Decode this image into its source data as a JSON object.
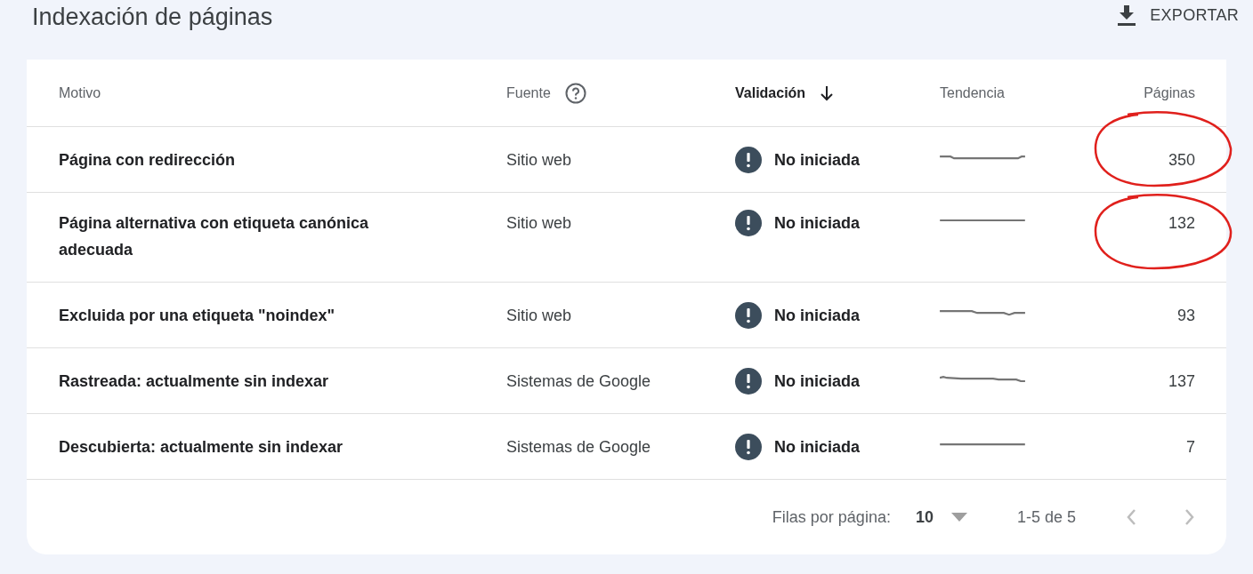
{
  "header": {
    "title": "Indexación de páginas",
    "export_label": "EXPORTAR"
  },
  "table": {
    "columns": [
      {
        "label": "Motivo",
        "help": false,
        "sorted": false
      },
      {
        "label": "Fuente",
        "help": true,
        "sorted": false
      },
      {
        "label": "Validación",
        "help": false,
        "sorted": true
      },
      {
        "label": "Tendencia",
        "help": false,
        "sorted": false
      },
      {
        "label": "Páginas",
        "help": false,
        "sorted": false
      }
    ],
    "rows": [
      {
        "reason": "Página con redirección",
        "source": "Sitio web",
        "validation": {
          "kind": "not_started",
          "label": "No iniciada"
        },
        "pages": "350",
        "circled": true
      },
      {
        "reason": "Página alternativa con etiqueta canónica adecuada",
        "source": "Sitio web",
        "validation": {
          "kind": "not_started",
          "label": "No iniciada"
        },
        "pages": "132",
        "circled": true
      },
      {
        "reason": "Excluida por una etiqueta \"noindex\"",
        "source": "Sitio web",
        "validation": {
          "kind": "not_started",
          "label": "No iniciada"
        },
        "pages": "93",
        "circled": false
      },
      {
        "reason": "Rastreada: actualmente sin indexar",
        "source": "Sistemas de Google",
        "validation": {
          "kind": "not_started",
          "label": "No iniciada"
        },
        "pages": "137",
        "circled": false
      },
      {
        "reason": "Descubierta: actualmente sin indexar",
        "source": "Sistemas de Google",
        "validation": {
          "kind": "not_started",
          "label": "No iniciada"
        },
        "pages": "7",
        "circled": false
      }
    ]
  },
  "pagination": {
    "rows_label": "Filas por página:",
    "rows_value": "10",
    "range": "1-5 de 5",
    "prev_disabled": true,
    "next_disabled": true
  }
}
